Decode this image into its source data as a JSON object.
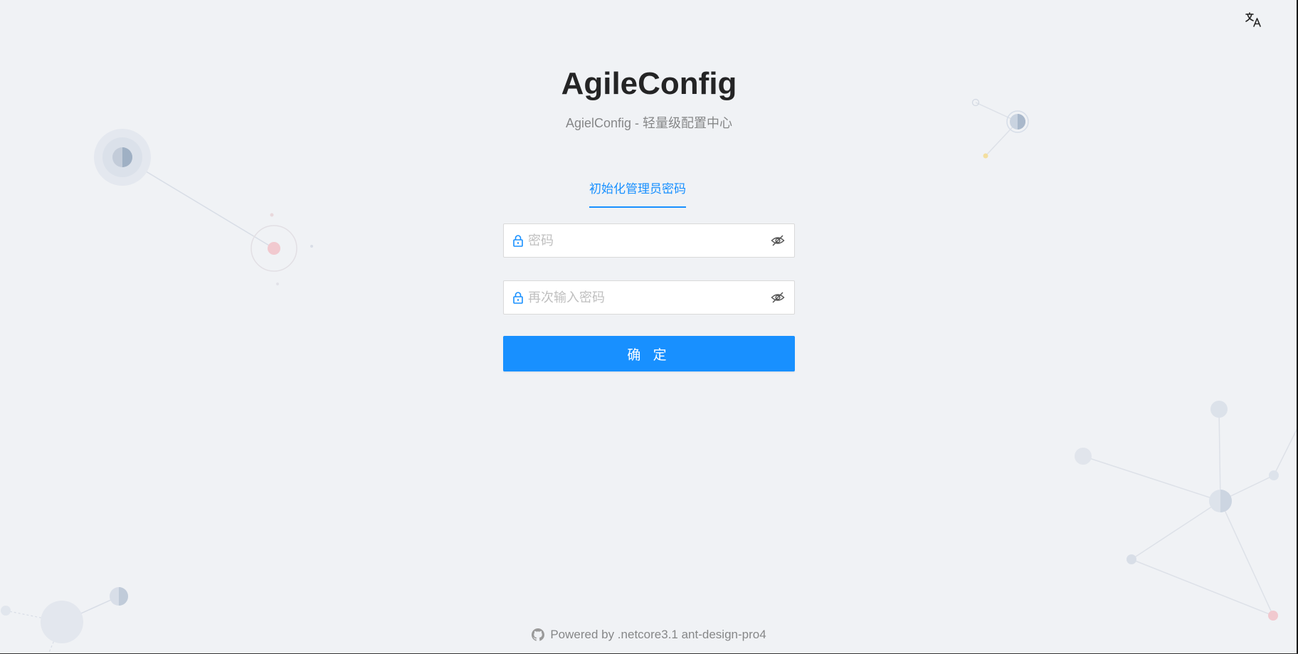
{
  "header": {
    "title": "AgileConfig",
    "subtitle": "AgielConfig - 轻量级配置中心"
  },
  "language": {
    "icon": "translate-icon"
  },
  "tabs": [
    {
      "label": "初始化管理员密码",
      "active": true
    }
  ],
  "form": {
    "password": {
      "placeholder": "密码",
      "value": "",
      "prefix_icon": "lock-icon",
      "suffix_icon": "eye-invisible-icon"
    },
    "confirm_password": {
      "placeholder": "再次输入密码",
      "value": "",
      "prefix_icon": "lock-icon",
      "suffix_icon": "eye-invisible-icon"
    },
    "submit_label": "确 定"
  },
  "footer": {
    "icon": "github-icon",
    "text": "Powered by .netcore3.1 ant-design-pro4"
  },
  "colors": {
    "primary": "#1890ff",
    "background": "#f0f2f5"
  }
}
